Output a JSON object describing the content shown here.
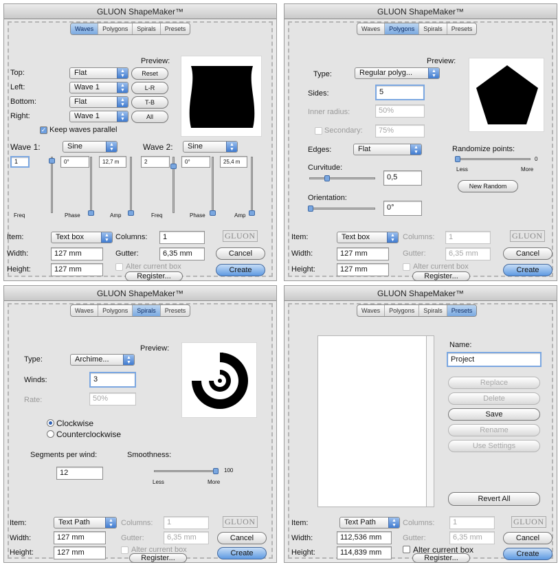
{
  "app_title": "GLUON ShapeMaker™",
  "tabs": [
    "Waves",
    "Polygons",
    "Spirals",
    "Presets"
  ],
  "logo": "GLUON",
  "common": {
    "item_label": "Item:",
    "width_label": "Width:",
    "height_label": "Height:",
    "columns_label": "Columns:",
    "gutter_label": "Gutter:",
    "alter_label": "Alter current box",
    "register_button": "Register...",
    "cancel_button": "Cancel",
    "create_button": "Create",
    "preview_label": "Preview:"
  },
  "waves": {
    "top_label": "Top:",
    "top_value": "Flat",
    "left_label": "Left:",
    "left_value": "Wave 1",
    "bottom_label": "Bottom:",
    "bottom_value": "Flat",
    "right_label": "Right:",
    "right_value": "Wave 1",
    "btn_reset": "Reset",
    "btn_lr": "L-R",
    "btn_tb": "T-B",
    "btn_all": "All",
    "keep_parallel": "Keep waves parallel",
    "wave1_label": "Wave 1:",
    "wave1_value": "Sine",
    "wave2_label": "Wave 2:",
    "wave2_value": "Sine",
    "w1_freq": "1",
    "w1_phase": "0°",
    "w1_amp": "12,7 m",
    "w2_freq": "2",
    "w2_phase": "0°",
    "w2_amp": "25,4 m",
    "freq_label": "Freq",
    "phase_label": "Phase",
    "amp_label": "Amp",
    "item_value": "Text box",
    "columns_value": "1",
    "gutter_value": "6,35 mm",
    "width_value": "127 mm",
    "height_value": "127 mm"
  },
  "polygons": {
    "type_label": "Type:",
    "type_value": "Regular polyg...",
    "sides_label": "Sides:",
    "sides_value": "5",
    "inner_radius_label": "Inner radius:",
    "inner_radius_value": "50%",
    "secondary_label": "Secondary:",
    "secondary_value": "75%",
    "edges_label": "Edges:",
    "edges_value": "Flat",
    "curvitude_label": "Curvitude:",
    "curvitude_value": "0,5",
    "orientation_label": "Orientation:",
    "orientation_value": "0°",
    "randomize_label": "Randomize points:",
    "randomize_value": "0",
    "less_label": "Less",
    "more_label": "More",
    "new_random_button": "New Random",
    "item_value": "Text box",
    "columns_value": "1",
    "gutter_value": "6,35 mm",
    "width_value": "127 mm",
    "height_value": "127 mm"
  },
  "spirals": {
    "type_label": "Type:",
    "type_value": "Archime...",
    "winds_label": "Winds:",
    "winds_value": "3",
    "rate_label": "Rate:",
    "rate_value": "50%",
    "clockwise_label": "Clockwise",
    "counterclockwise_label": "Counterclockwise",
    "segments_label": "Segments per wind:",
    "segments_value": "12",
    "smoothness_label": "Smoothness:",
    "smoothness_value": "100",
    "less_label": "Less",
    "more_label": "More",
    "item_value": "Text Path",
    "columns_value": "1",
    "gutter_value": "6,35 mm",
    "width_value": "127 mm",
    "height_value": "127 mm"
  },
  "presets": {
    "name_label": "Name:",
    "name_value": "Project",
    "replace_button": "Replace",
    "delete_button": "Delete",
    "save_button": "Save",
    "rename_button": "Rename",
    "use_settings_button": "Use Settings",
    "revert_all_button": "Revert All",
    "item_value": "Text Path",
    "columns_value": "1",
    "gutter_value": "6,35 mm",
    "width_value": "112,536 mm",
    "height_value": "114,839 mm"
  }
}
